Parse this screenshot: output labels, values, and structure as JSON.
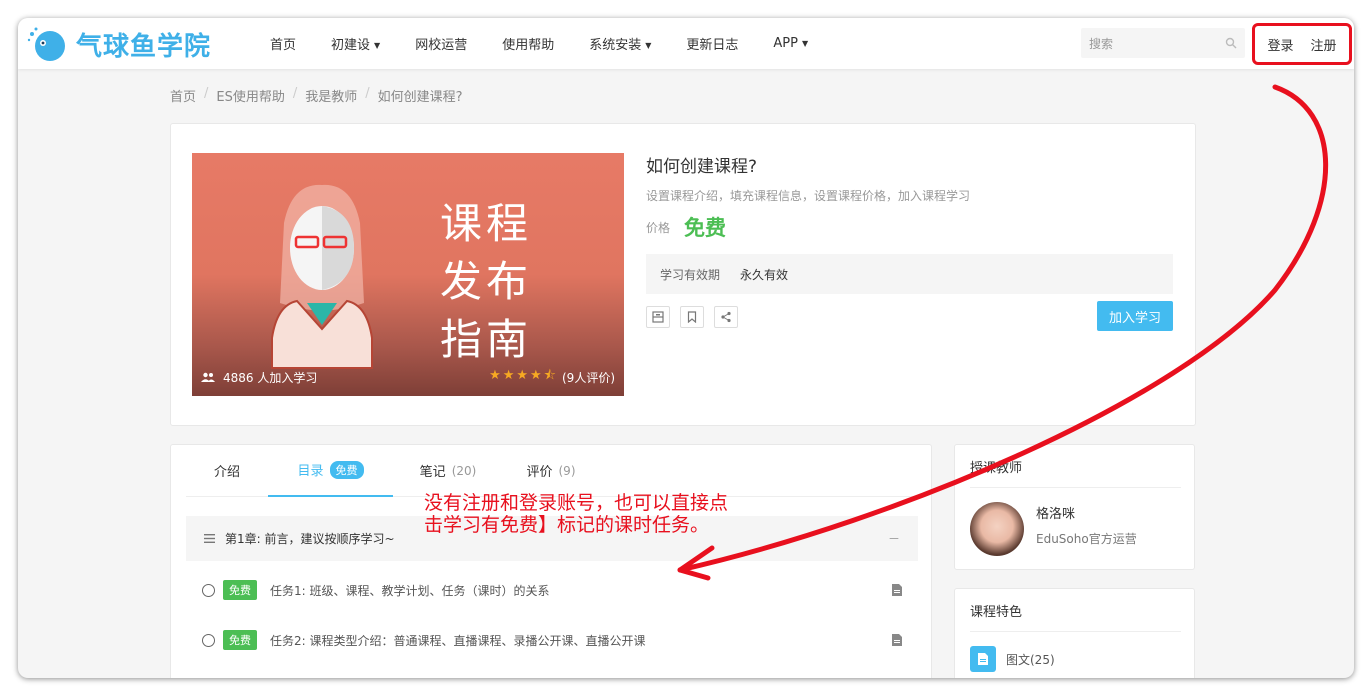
{
  "navbar": {
    "logo_text": "气球鱼学院",
    "items": [
      {
        "label": "首页",
        "has_caret": false
      },
      {
        "label": "初建设",
        "has_caret": true
      },
      {
        "label": "网校运营",
        "has_caret": false
      },
      {
        "label": "使用帮助",
        "has_caret": false
      },
      {
        "label": "系统安装",
        "has_caret": true
      },
      {
        "label": "更新日志",
        "has_caret": false
      },
      {
        "label": "APP",
        "has_caret": true
      }
    ],
    "search_placeholder": "搜索",
    "login": "登录",
    "register": "注册"
  },
  "breadcrumb": [
    "首页",
    "ES使用帮助",
    "我是教师",
    "如何创建课程?"
  ],
  "course": {
    "cover_title": [
      "课程",
      "发布",
      "指南"
    ],
    "students": "4886 人加入学习",
    "rating_text": "(9人评价)",
    "rating": 4.5,
    "title": "如何创建课程?",
    "subtitle": "设置课程介绍，填充课程信息，设置课程价格，加入课程学习",
    "price_label": "价格",
    "price": "免费",
    "validity_label": "学习有效期",
    "validity_value": "永久有效",
    "join_button": "加入学习"
  },
  "tabs": {
    "intro": "介绍",
    "catalog": "目录",
    "catalog_badge": "免费",
    "notes": "笔记",
    "notes_count": "(20)",
    "reviews": "评价",
    "reviews_count": "(9)"
  },
  "chapter": {
    "title": "第1章: 前言，建议按顺序学习~",
    "toggle": "－"
  },
  "tasks": [
    {
      "badge": "免费",
      "text": "任务1:  班级、课程、教学计划、任务（课时）的关系"
    },
    {
      "badge": "免费",
      "text": "任务2:  课程类型介绍：普通课程、直播课程、录播公开课、直播公开课"
    }
  ],
  "teacher": {
    "heading": "授课教师",
    "name": "格洛咪",
    "org": "EduSoho官方运营"
  },
  "features": {
    "heading": "课程特色",
    "item": "图文(25)"
  },
  "annotation": {
    "line1": "没有注册和登录账号，也可以直接点",
    "line2": "击学习有免费】标记的课时任务。"
  },
  "colors": {
    "accent": "#43bbf0",
    "free_green": "#4cbe54",
    "annotation_red": "#e8101e",
    "star": "#f7a922"
  }
}
